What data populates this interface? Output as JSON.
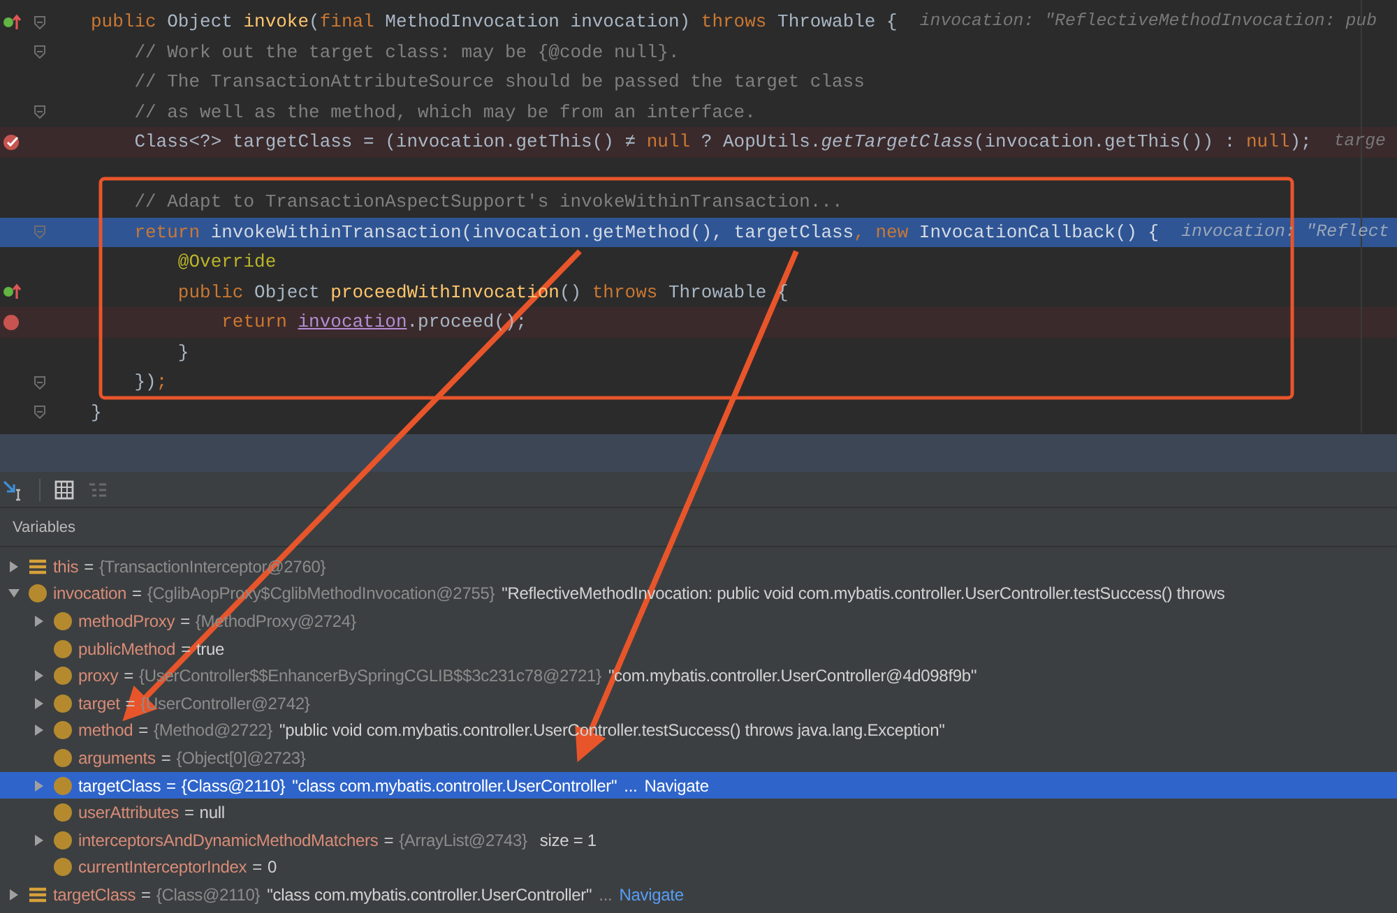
{
  "editor": {
    "lines": [
      {
        "override_mark": true,
        "breakpoint": false,
        "breakpoint_verified": false,
        "execution_point": false,
        "fold": true,
        "tokens": [
          {
            "kind": "kw",
            "text": "public "
          },
          {
            "kind": "plain",
            "text": "Object "
          },
          {
            "kind": "method",
            "text": "invoke"
          },
          {
            "kind": "plain",
            "text": "("
          },
          {
            "kind": "kw",
            "text": "final "
          },
          {
            "kind": "plain",
            "text": "MethodInvocation invocation) "
          },
          {
            "kind": "kw",
            "text": "throws "
          },
          {
            "kind": "plain",
            "text": "Throwable {"
          }
        ],
        "hint": "invocation: \"ReflectiveMethodInvocation: pub"
      },
      {
        "override_mark": false,
        "breakpoint": false,
        "breakpoint_verified": false,
        "execution_point": false,
        "fold": true,
        "tokens": [
          {
            "kind": "comment",
            "text": "    // Work out the target class: may be {@code null}."
          }
        ]
      },
      {
        "override_mark": false,
        "breakpoint": false,
        "breakpoint_verified": false,
        "execution_point": false,
        "fold": false,
        "tokens": [
          {
            "kind": "comment",
            "text": "    // The TransactionAttributeSource should be passed the target class"
          }
        ]
      },
      {
        "override_mark": false,
        "breakpoint": false,
        "breakpoint_verified": false,
        "execution_point": false,
        "fold": true,
        "tokens": [
          {
            "kind": "comment",
            "text": "    // as well as the method, which may be from an interface."
          }
        ]
      },
      {
        "override_mark": false,
        "breakpoint": true,
        "breakpoint_verified": true,
        "execution_point": false,
        "fold": false,
        "tokens": [
          {
            "kind": "plain",
            "text": "    Class<?> targetClass = (invocation.getThis() ≠ "
          },
          {
            "kind": "kw",
            "text": "null"
          },
          {
            "kind": "plain",
            "text": " ? AopUtils."
          },
          {
            "kind": "italic",
            "text": "getTargetClass"
          },
          {
            "kind": "plain",
            "text": "(invocation.getThis()) : "
          },
          {
            "kind": "kw",
            "text": "null"
          },
          {
            "kind": "plain",
            "text": ");"
          }
        ],
        "hint": "targe"
      },
      {
        "override_mark": false,
        "breakpoint": false,
        "breakpoint_verified": false,
        "execution_point": false,
        "fold": false
      },
      {
        "override_mark": false,
        "breakpoint": false,
        "breakpoint_verified": false,
        "execution_point": false,
        "fold": false,
        "tokens": [
          {
            "kind": "comment",
            "text": "    // Adapt to TransactionAspectSupport's invokeWithinTransaction..."
          }
        ]
      },
      {
        "override_mark": false,
        "breakpoint": false,
        "breakpoint_verified": false,
        "execution_point": true,
        "fold": true,
        "tokens": [
          {
            "kind": "kw",
            "text": "    return "
          },
          {
            "kind": "plain",
            "text": "invokeWithinTransaction(invocation.getMethod(), targetClass"
          },
          {
            "kind": "kw",
            "text": ", new "
          },
          {
            "kind": "plain",
            "text": "InvocationCallback() {"
          }
        ],
        "hint": "invocation: \"Reflect"
      },
      {
        "override_mark": false,
        "breakpoint": false,
        "breakpoint_verified": false,
        "execution_point": false,
        "fold": false,
        "tokens": [
          {
            "kind": "anno",
            "text": "        @Override"
          }
        ]
      },
      {
        "override_mark": true,
        "breakpoint": false,
        "breakpoint_verified": false,
        "execution_point": false,
        "fold": false,
        "tokens": [
          {
            "kind": "kw",
            "text": "        public "
          },
          {
            "kind": "plain",
            "text": "Object "
          },
          {
            "kind": "method",
            "text": "proceedWithInvocation"
          },
          {
            "kind": "plain",
            "text": "() "
          },
          {
            "kind": "kw",
            "text": "throws "
          },
          {
            "kind": "plain",
            "text": "Throwable {"
          }
        ]
      },
      {
        "override_mark": false,
        "breakpoint": true,
        "breakpoint_verified": false,
        "execution_point": false,
        "fold": false,
        "tokens": [
          {
            "kind": "kw",
            "text": "            return "
          },
          {
            "kind": "ref",
            "text": "invocation"
          },
          {
            "kind": "plain",
            "text": ".proceed();"
          }
        ]
      },
      {
        "override_mark": false,
        "breakpoint": false,
        "breakpoint_verified": false,
        "execution_point": false,
        "fold": false,
        "tokens": [
          {
            "kind": "plain",
            "text": "        }"
          }
        ]
      },
      {
        "override_mark": false,
        "breakpoint": false,
        "breakpoint_verified": false,
        "execution_point": false,
        "fold": true,
        "tokens": [
          {
            "kind": "plain",
            "text": "    })"
          },
          {
            "kind": "kw",
            "text": ";"
          }
        ]
      },
      {
        "override_mark": false,
        "breakpoint": false,
        "breakpoint_verified": false,
        "execution_point": false,
        "fold": true,
        "tokens": [
          {
            "kind": "plain",
            "text": "}"
          }
        ]
      }
    ]
  },
  "debugger": {
    "panel_title": "Variables",
    "variables": [
      {
        "kind": "local",
        "name": "this",
        "equals": "=",
        "ref": "{TransactionInterceptor@2760}",
        "expanded": false,
        "selected": false
      },
      {
        "kind": "param",
        "name": "invocation",
        "equals": "=",
        "ref": "{CglibAopProxy$CglibMethodInvocation@2755}",
        "value": "\"ReflectiveMethodInvocation: public void com.mybatis.controller.UserController.testSuccess() throws",
        "expanded": true,
        "selected": false,
        "children": [
          {
            "kind": "field",
            "name": "methodProxy",
            "equals": "=",
            "ref": "{MethodProxy@2724}",
            "expanded": false,
            "selected": false
          },
          {
            "kind": "field",
            "name": "publicMethod",
            "equals": "=",
            "value": "true",
            "selected": false
          },
          {
            "kind": "field",
            "name": "proxy",
            "equals": "=",
            "ref": "{UserController$$EnhancerBySpringCGLIB$$3c231c78@2721}",
            "value": "\"com.mybatis.controller.UserController@4d098f9b\"",
            "expanded": false,
            "selected": false
          },
          {
            "kind": "field",
            "name": "target",
            "equals": "=",
            "ref": "{UserController@2742}",
            "expanded": false,
            "selected": false
          },
          {
            "kind": "field",
            "name": "method",
            "equals": "=",
            "ref": "{Method@2722}",
            "value": "\"public void com.mybatis.controller.UserController.testSuccess() throws java.lang.Exception\"",
            "expanded": false,
            "selected": false
          },
          {
            "kind": "field",
            "name": "arguments",
            "equals": "=",
            "ref": "{Object[0]@2723}",
            "selected": false
          },
          {
            "kind": "field",
            "name": "targetClass",
            "equals": "=",
            "ref": "{Class@2110}",
            "value": "\"class com.mybatis.controller.UserController\"",
            "ellipsis": "...",
            "link": "Navigate",
            "expanded": false,
            "selected": true
          },
          {
            "kind": "field",
            "name": "userAttributes",
            "equals": "=",
            "value": "null",
            "selected": false
          },
          {
            "kind": "field",
            "name": "interceptorsAndDynamicMethodMatchers",
            "equals": "=",
            "ref": "{ArrayList@2743}",
            "extra": "size = 1",
            "expanded": false,
            "selected": false
          },
          {
            "kind": "field",
            "name": "currentInterceptorIndex",
            "equals": "=",
            "value": "0",
            "selected": false
          }
        ]
      },
      {
        "kind": "local",
        "name": "targetClass",
        "equals": "=",
        "ref": "{Class@2110}",
        "value": "\"class com.mybatis.controller.UserController\"",
        "ellipsis": "...",
        "link": "Navigate",
        "expanded": false,
        "selected": false
      }
    ]
  }
}
